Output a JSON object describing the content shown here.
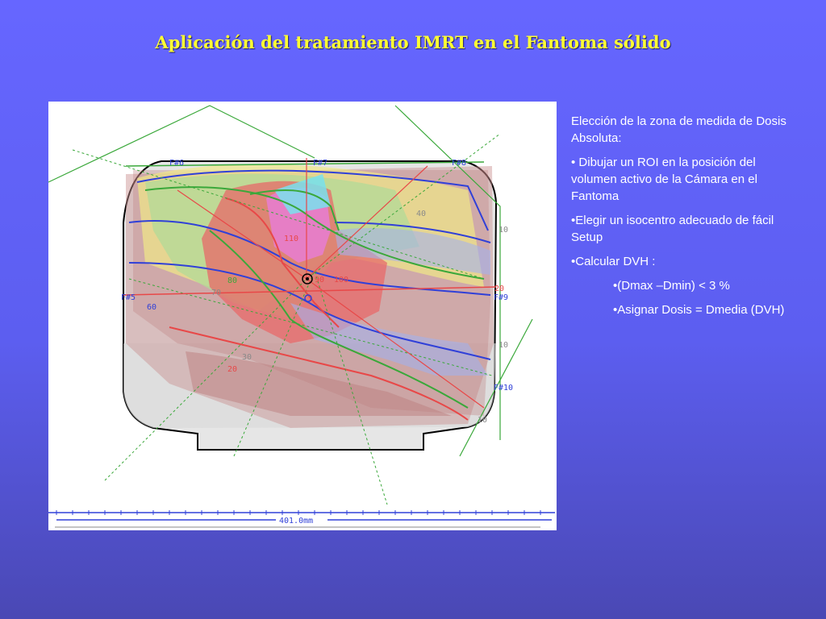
{
  "title": "Aplicación del tratamiento IMRT en el Fantoma sólido",
  "text": {
    "intro": "Elección de la zona de medida de Dosis Absoluta:",
    "bullet1": "• Dibujar un ROI en la posición del volumen activo de la Cámara en el Fantoma",
    "bullet2": "•Elegir un isocentro adecuado de fácil Setup",
    "bullet3": "•Calcular DVH :",
    "sub1": "•(Dmax –Dmin) < 3 %",
    "sub2": "•Asignar Dosis = Dmedia (DVH)"
  },
  "figure": {
    "beams": [
      "F#6",
      "F#7",
      "F#8",
      "F#9",
      "F#10",
      "F#5"
    ],
    "isodose_labels": [
      "20",
      "30",
      "40",
      "60",
      "70",
      "80",
      "90",
      "100",
      "110",
      "10",
      "20",
      "10",
      "10"
    ],
    "scale_label": "401.0mm",
    "colors": {
      "red": "#e84848",
      "green": "#3aa83a",
      "blue": "#3040d8",
      "yellow": "#f2ea78",
      "magenta": "#e86cd8",
      "cyan": "#66e0f0",
      "brown": "#b87070",
      "gray": "#8a8a8a"
    }
  }
}
